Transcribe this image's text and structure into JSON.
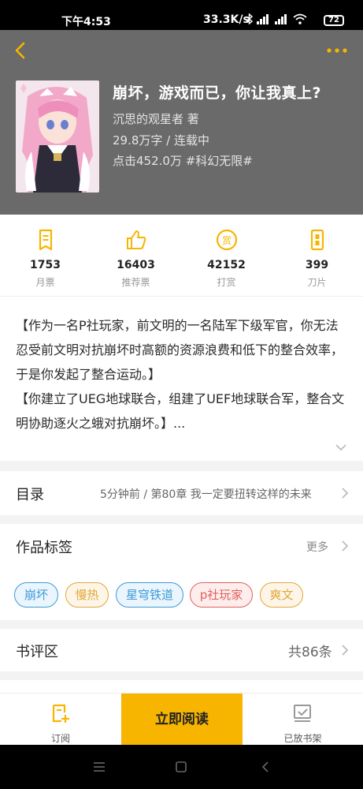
{
  "status_bar": {
    "time": "下午4:53",
    "net_speed": "33.3K/s",
    "battery": "72"
  },
  "header": {
    "back_icon": "back-chevron-icon",
    "more_icon": "more-dots-icon"
  },
  "book": {
    "title": "崩坏，游戏而已，你让我真上?",
    "author_line": "沉思的观星者  著",
    "words_status": "29.8万字 / 连载中",
    "clicks_tag": "点击452.0万  #科幻无限#"
  },
  "stats": [
    {
      "value": "1753",
      "label": "月票",
      "icon": "monthly-ticket-icon"
    },
    {
      "value": "16403",
      "label": "推荐票",
      "icon": "thumbs-up-icon"
    },
    {
      "value": "42152",
      "label": "打赏",
      "icon": "reward-coin-icon"
    },
    {
      "value": "399",
      "label": "刀片",
      "icon": "blade-icon"
    }
  ],
  "synopsis": {
    "para1": "【作为一名P社玩家，前文明的一名陆军下级军官，你无法忍受前文明对抗崩坏时高额的资源浪费和低下的整合效率，于是你发起了整合运动。】",
    "para2": "【你建立了UEG地球联合，组建了UEF地球联合军，整合文明协助逐火之蛾对抗崩坏。】..."
  },
  "toc": {
    "title": "目录",
    "latest": "5分钟前 / 第80章 我一定要扭转这样的未来"
  },
  "tags_section": {
    "title": "作品标签",
    "more": "更多",
    "tags": [
      {
        "label": "崩坏",
        "color": "#3d9bd8",
        "bg": "#eaf5fd"
      },
      {
        "label": "慢热",
        "color": "#e2a636",
        "bg": "#fdf6e8"
      },
      {
        "label": "星穹铁道",
        "color": "#3d9bd8",
        "bg": "#eaf5fd"
      },
      {
        "label": "p社玩家",
        "color": "#e0605a",
        "bg": "#fdeeed"
      },
      {
        "label": "爽文",
        "color": "#e2a636",
        "bg": "#fdf6e8"
      }
    ]
  },
  "reviews": {
    "title": "书评区",
    "count": "共86条"
  },
  "bottom_bar": {
    "subscribe": "订阅",
    "read_now": "立即阅读",
    "on_shelf": "已放书架"
  },
  "colors": {
    "accent": "#f7b500",
    "hero_bg": "#6a6a6a"
  }
}
